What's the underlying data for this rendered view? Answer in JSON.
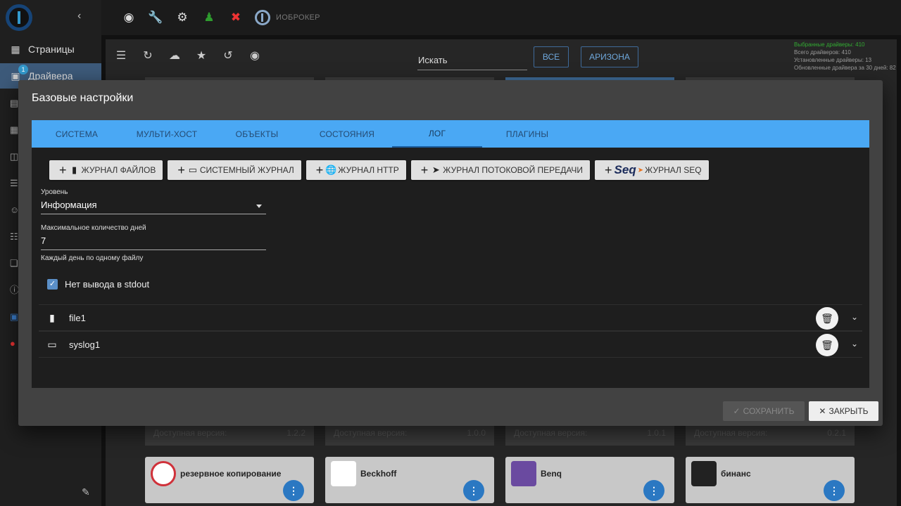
{
  "sidebar": {
    "collapse_icon": "chevron-left-icon",
    "items": [
      {
        "label": "Страницы",
        "icon": "grid-icon"
      },
      {
        "label": "Драйвера",
        "icon": "drivers-icon",
        "badge": "1"
      }
    ]
  },
  "topbar": {
    "icons": [
      "eye-icon",
      "wrench-icon",
      "gear-icon",
      "user-icon",
      "wrench-red-icon"
    ],
    "brand": "ИОБРОКЕР"
  },
  "toolbar": {
    "search_label": "Искать",
    "btn_all": "ВСЕ",
    "btn_arizona": "АРИЗОНА",
    "stats": [
      "Выбранные драйверы: 410",
      "Всего драйверов: 410",
      "Установленные драйверы: 13",
      "Обновленные драйвера за 30 дней: 82"
    ]
  },
  "cards": [
    {
      "title": "резервное копирование"
    },
    {
      "title": "Beckhoff"
    },
    {
      "title": "Benq"
    },
    {
      "title": "бинанс"
    }
  ],
  "avail": [
    {
      "label": "Доступная версия:",
      "version": "1.2.2"
    },
    {
      "label": "Доступная версия:",
      "version": "1.0.0"
    },
    {
      "label": "Доступная версия:",
      "version": "1.0.1"
    },
    {
      "label": "Доступная версия:",
      "version": "0.2.1"
    }
  ],
  "dialog": {
    "title": "Базовые настройки",
    "tabs": [
      "СИСТЕМА",
      "МУЛЬТИ-ХОСТ",
      "ОБЪЕКТЫ",
      "СОСТОЯНИЯ",
      "ЛОГ",
      "ПЛАГИНЫ"
    ],
    "active_tab": "ЛОГ",
    "add_buttons": [
      {
        "label": "ЖУРНАЛ ФАЙЛОВ",
        "icon": "file-icon"
      },
      {
        "label": "СИСТЕМНЫЙ ЖУРНАЛ",
        "icon": "laptop-icon"
      },
      {
        "label": "ЖУРНАЛ HTTP",
        "icon": "globe-icon"
      },
      {
        "label": "ЖУРНАЛ ПОТОКОВОЙ ПЕРЕДАЧИ",
        "icon": "send-icon"
      },
      {
        "label": "ЖУРНАЛ SEQ",
        "icon": "seq-logo-icon",
        "logo_text": "Seq"
      }
    ],
    "level_label": "Уровень",
    "level_value": "Информация",
    "days_label": "Максимальное количество дней",
    "days_value": "7",
    "days_helper": "Каждый день по одному файлу",
    "no_stdout_label": "Нет вывода в stdout",
    "no_stdout_checked": true,
    "transports": [
      {
        "name": "file1",
        "icon": "file-icon"
      },
      {
        "name": "syslog1",
        "icon": "laptop-icon"
      }
    ],
    "save_label": "СОХРАНИТЬ",
    "close_label": "ЗАКРЫТЬ"
  },
  "colors": {
    "tab_bar": "#4aa8f4",
    "dialog_bg": "#424242",
    "body_bg": "#1e1e1e",
    "accent": "#2b78c2"
  }
}
